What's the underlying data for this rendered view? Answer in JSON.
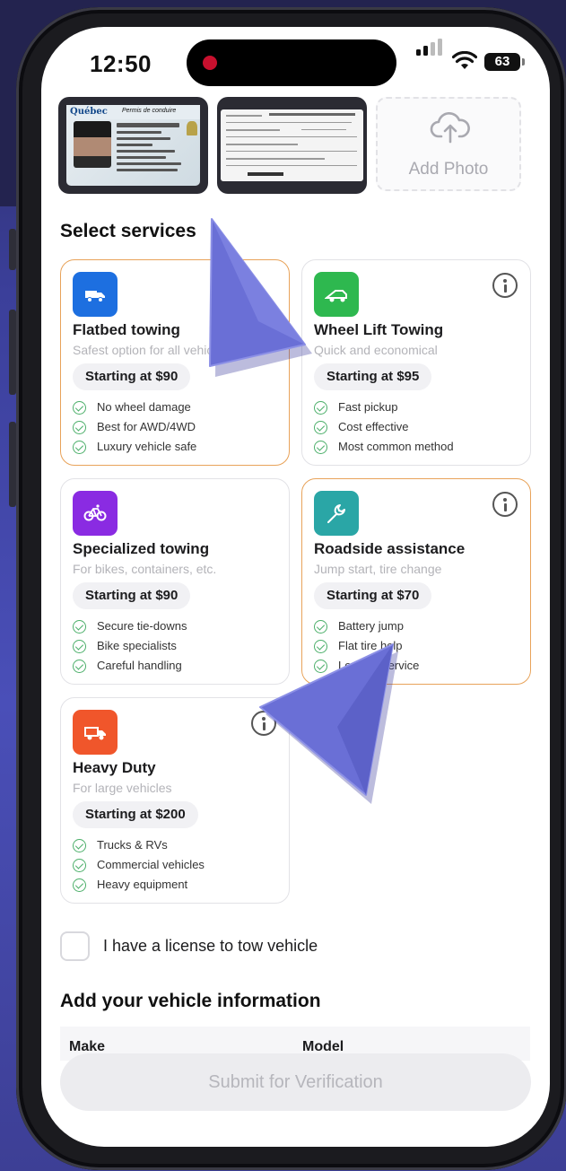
{
  "status_bar": {
    "time": "12:50",
    "battery": "63"
  },
  "photos": {
    "license_header": "Québec",
    "license_title": "Permis de conduire",
    "add_label": "Add Photo"
  },
  "services_section": {
    "title": "Select services"
  },
  "services": [
    {
      "title": "Flatbed towing",
      "subtitle": "Safest option for all vehicles",
      "price": "Starting at $90",
      "features": [
        "No wheel damage",
        "Best for AWD/4WD",
        "Luxury vehicle safe"
      ],
      "icon": "flatbed-truck-icon",
      "color": "#1d6fe0",
      "selected": true
    },
    {
      "title": "Wheel Lift Towing",
      "subtitle": "Quick and economical",
      "price": "Starting at $95",
      "features": [
        "Fast pickup",
        "Cost effective",
        "Most common method"
      ],
      "icon": "tow-truck-icon",
      "color": "#2eb84f",
      "selected": false
    },
    {
      "title": "Specialized towing",
      "subtitle": "For bikes, containers, etc.",
      "price": "Starting at $90",
      "features": [
        "Secure tie-downs",
        "Bike specialists",
        "Careful handling"
      ],
      "icon": "bike-icon",
      "color": "#8a2be2",
      "selected": false
    },
    {
      "title": "Roadside assistance",
      "subtitle": "Jump start, tire change",
      "price": "Starting at $70",
      "features": [
        "Battery jump",
        "Flat tire help",
        "Lockout service"
      ],
      "icon": "wrench-icon",
      "color": "#2aa6a6",
      "selected": true
    },
    {
      "title": "Heavy Duty",
      "subtitle": "For large vehicles",
      "price": "Starting at $200",
      "features": [
        "Trucks & RVs",
        "Commercial vehicles",
        "Heavy equipment"
      ],
      "icon": "heavy-truck-icon",
      "color": "#f0562b",
      "selected": false
    }
  ],
  "license_checkbox": {
    "label": "I have a license to tow vehicle",
    "checked": false
  },
  "vehicle_section": {
    "title": "Add your vehicle information",
    "columns": [
      "Make",
      "Model"
    ]
  },
  "submit": {
    "label": "Submit for Verification"
  }
}
